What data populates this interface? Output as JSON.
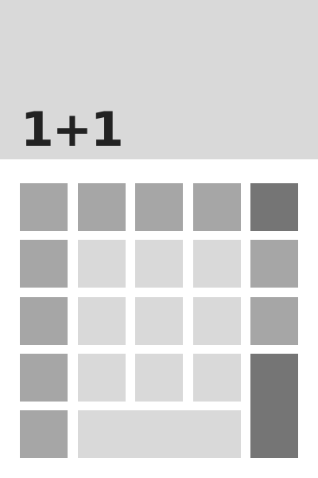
{
  "display": {
    "expression": "1+1"
  },
  "colors": {
    "display_background": "#d9d9d9",
    "digit_key": "#d9d9d9",
    "function_key": "#a6a6a6",
    "action_key": "#757575",
    "display_text": "#222222"
  },
  "keypad": {
    "rows": 5,
    "columns": 5,
    "keys_have_labels": false
  }
}
